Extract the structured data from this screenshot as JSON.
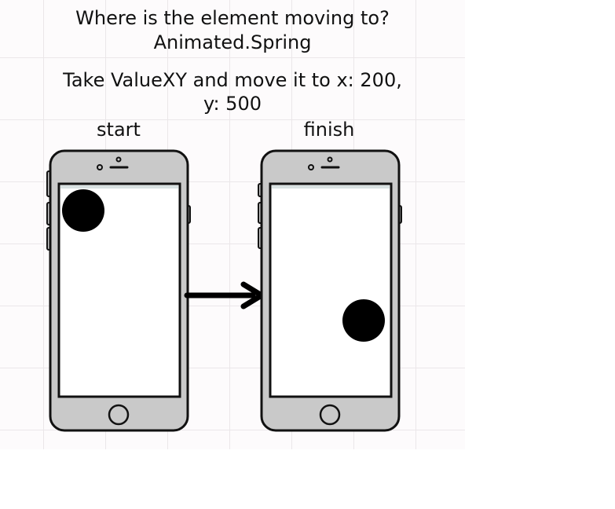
{
  "title": {
    "line1": "Where is the element moving to?",
    "line2": "Animated.Spring"
  },
  "instruction": {
    "line1": "Take ValueXY and move it to x: 200,",
    "line2": "y: 500"
  },
  "phones": {
    "start_label": "start",
    "finish_label": "finish"
  },
  "colors": {
    "phone_body": "#c9c9c9",
    "screen": "#ffffff",
    "ball": "#000000",
    "outline": "#111111"
  }
}
